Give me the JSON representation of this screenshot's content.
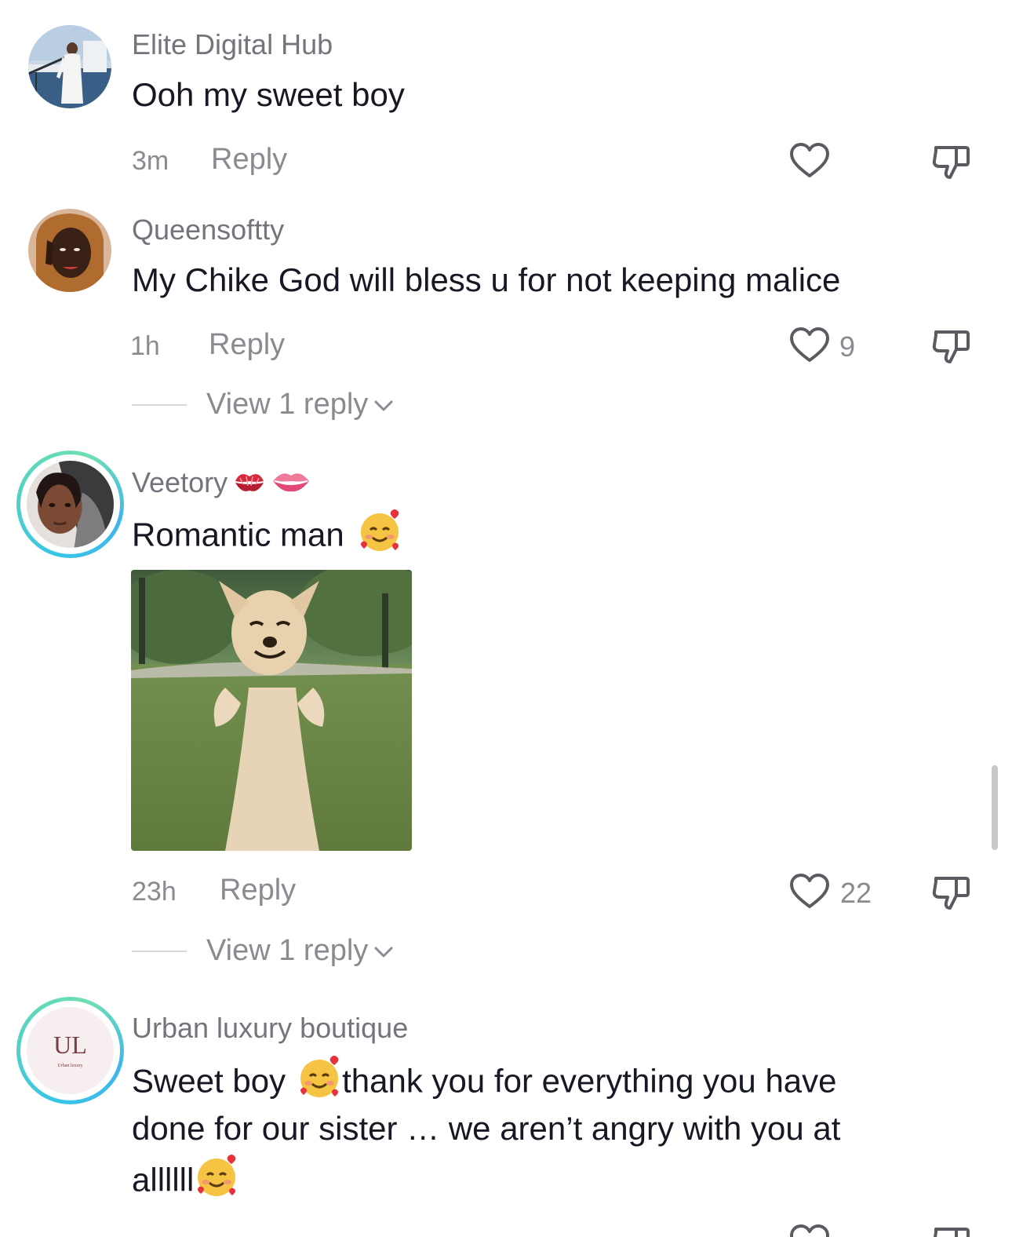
{
  "comments": [
    {
      "username": "Elite Digital Hub",
      "text": "Ooh my sweet boy",
      "time": "3m",
      "reply_label": "Reply",
      "likes": ""
    },
    {
      "username": "Queensoftty",
      "text": "My Chike God will bless u for not keeping malice",
      "time": "1h",
      "reply_label": "Reply",
      "likes": "9",
      "view_replies": "View 1 reply"
    },
    {
      "username": "Veetory",
      "text": "Romantic man",
      "time": "23h",
      "reply_label": "Reply",
      "likes": "22",
      "view_replies": "View 1 reply",
      "sticker": "smiling-chihuahua-sticker"
    },
    {
      "username": "Urban luxury boutique",
      "text_line1": "Sweet boy",
      "text_line1b": "thank you for everything you have",
      "text_line2": "done for our sister … we aren’t angry with you at",
      "text_line3": "allllll",
      "avatar_logo": "UL",
      "avatar_logo_sub": "Urban luxury"
    }
  ],
  "icons": {
    "like": "heart-outline-icon",
    "dislike": "thumbs-down-icon",
    "expand": "chevron-down-icon",
    "emoji_love": "smiling-face-with-hearts",
    "emoji_kiss": "kiss-mark",
    "emoji_lips": "lips"
  },
  "colors": {
    "text": "#161823",
    "secondary": "#8a8b91",
    "username": "#73757c",
    "ring_start": "#38c6e6",
    "ring_end": "#6fe0b0"
  }
}
